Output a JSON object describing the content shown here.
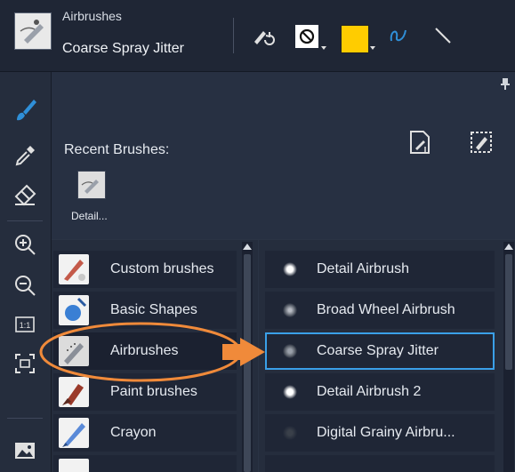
{
  "header": {
    "category": "Airbrushes",
    "brush_name": "Coarse Spray Jitter",
    "color_swatch": "#ffcc00",
    "icons": [
      "brush-reset-icon",
      "no-circle-icon",
      "color-swatch",
      "stroke-curve-icon",
      "line-icon"
    ]
  },
  "toolstrip": {
    "tools": [
      "paint-brush-icon",
      "eyedropper-icon",
      "eraser-icon",
      "zoom-in-icon",
      "zoom-out-icon",
      "actual-size-icon",
      "fit-to-screen-icon",
      "image-icon"
    ]
  },
  "recent": {
    "label": "Recent Brushes:",
    "items": [
      {
        "label": "Detail..."
      }
    ]
  },
  "categories": [
    {
      "label": "Custom brushes",
      "selected": false
    },
    {
      "label": "Basic Shapes",
      "selected": false
    },
    {
      "label": "Airbrushes",
      "selected": true
    },
    {
      "label": "Paint brushes",
      "selected": false
    },
    {
      "label": "Crayon",
      "selected": false
    }
  ],
  "brushes": [
    {
      "label": "Detail Airbrush",
      "selected": false
    },
    {
      "label": "Broad Wheel Airbrush",
      "selected": false
    },
    {
      "label": "Coarse Spray Jitter",
      "selected": true
    },
    {
      "label": "Detail Airbrush 2",
      "selected": false
    },
    {
      "label": "Digital Grainy Airbru...",
      "selected": false
    }
  ],
  "colors": {
    "accent": "#2f8fd8",
    "annotation": "#f08a3a",
    "highlight_border": "#3aa0e8"
  }
}
